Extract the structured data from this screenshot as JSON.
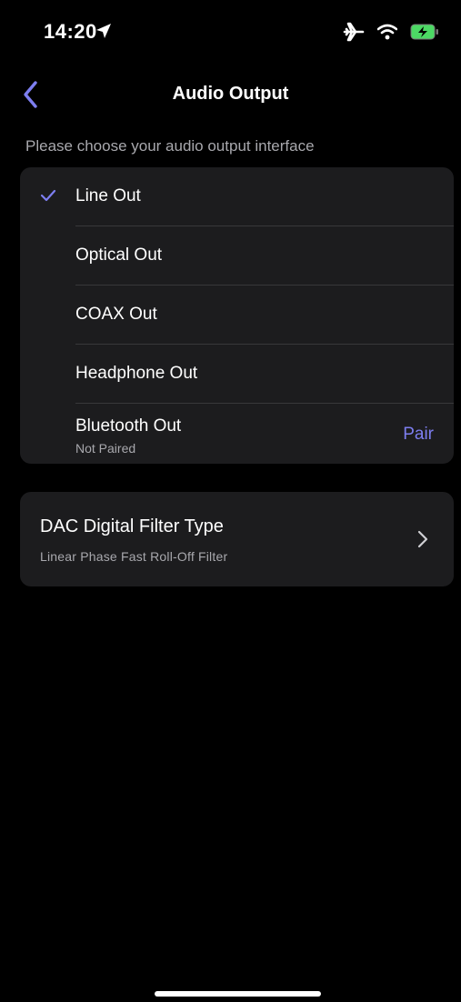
{
  "status_bar": {
    "time": "14:20",
    "icons": [
      "location-arrow-icon",
      "airplane-icon",
      "wifi-icon",
      "battery-charging-icon"
    ]
  },
  "nav": {
    "title": "Audio Output",
    "back_icon": "chevron-left-icon"
  },
  "section_caption": "Please choose your audio output interface",
  "outputs": [
    {
      "label": "Line Out",
      "selected": true
    },
    {
      "label": "Optical Out",
      "selected": false
    },
    {
      "label": "COAX Out",
      "selected": false
    },
    {
      "label": "Headphone Out",
      "selected": false
    },
    {
      "label": "Bluetooth Out",
      "selected": false,
      "status": "Not Paired",
      "action": "Pair"
    }
  ],
  "dac_filter": {
    "title": "DAC Digital Filter Type",
    "value": "Linear Phase Fast Roll-Off Filter"
  },
  "colors": {
    "accent": "#7d7ef0",
    "background": "#000000",
    "card": "#1c1c1e",
    "secondary_text": "#a8a8ad"
  }
}
